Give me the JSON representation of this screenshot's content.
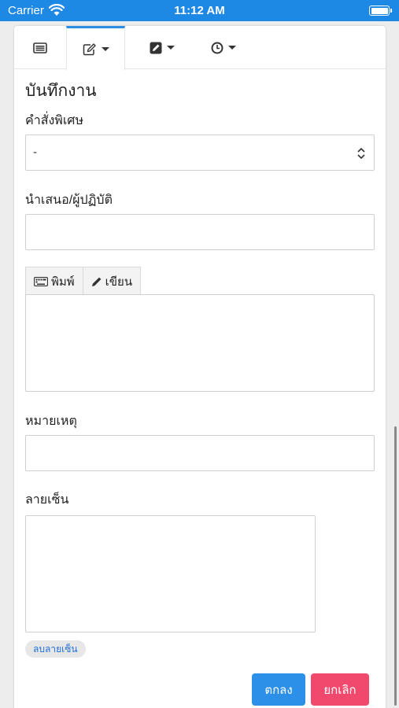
{
  "status_bar": {
    "carrier": "Carrier",
    "time": "11:12 AM"
  },
  "tabs": [
    {
      "icon": "list-icon",
      "active": false
    },
    {
      "icon": "edit-icon",
      "active": true,
      "dropdown": true
    },
    {
      "icon": "pencil-square-icon",
      "active": false,
      "dropdown": true
    },
    {
      "icon": "clock-icon",
      "active": false,
      "dropdown": true
    }
  ],
  "form": {
    "title": "บันทึกงาน",
    "special_order_label": "คำสั่งพิเศษ",
    "special_order_value": "-",
    "presenter_label": "นำเสนอ/ผู้ปฏิบัติ",
    "presenter_value": "",
    "input_modes": {
      "type_label": "พิมพ์",
      "write_label": "เขียน"
    },
    "note_label": "หมายเหตุ",
    "note_value": "",
    "signature_label": "ลายเซ็น",
    "clear_signature_label": "ลบลายเซ็น"
  },
  "actions": {
    "ok_label": "ตกลง",
    "cancel_label": "ยกเลิก"
  },
  "colors": {
    "status_bar": "#1e88e5",
    "primary": "#2c8fe8",
    "danger": "#f1496d",
    "active_tab": "#2b8ee6"
  }
}
